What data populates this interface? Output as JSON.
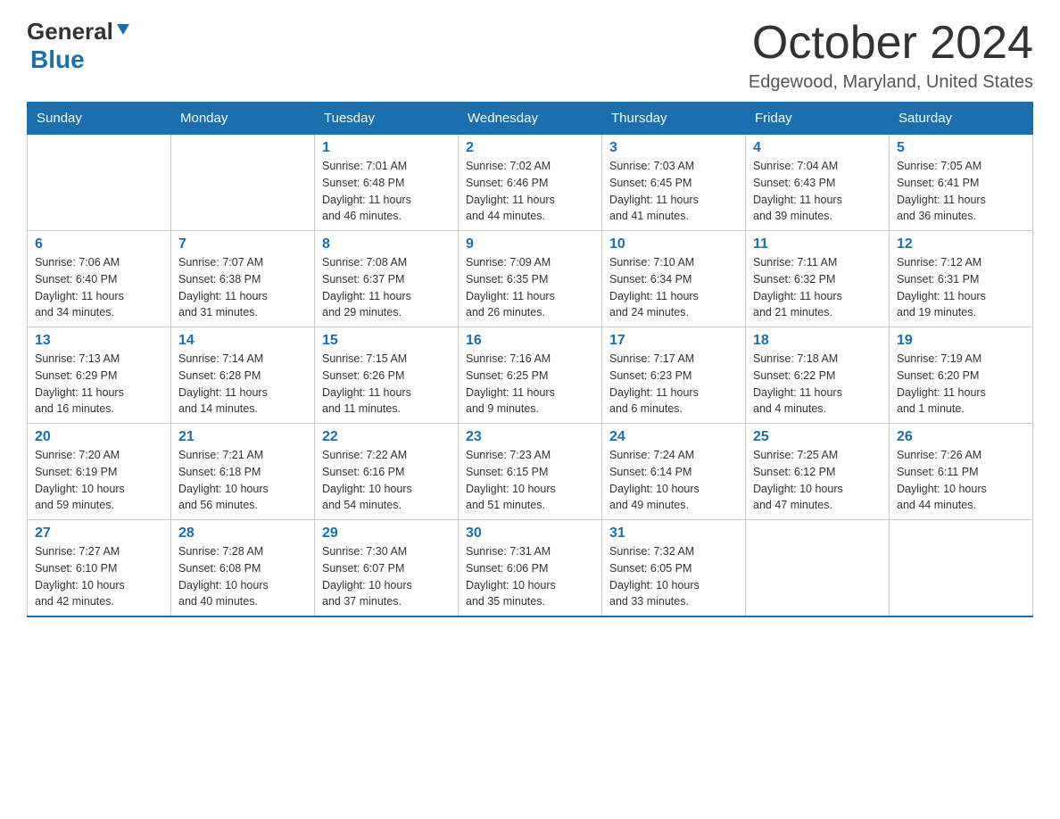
{
  "header": {
    "logo_general": "General",
    "logo_blue": "Blue",
    "title": "October 2024",
    "subtitle": "Edgewood, Maryland, United States"
  },
  "calendar": {
    "headers": [
      "Sunday",
      "Monday",
      "Tuesday",
      "Wednesday",
      "Thursday",
      "Friday",
      "Saturday"
    ],
    "weeks": [
      [
        {
          "day": "",
          "info": ""
        },
        {
          "day": "",
          "info": ""
        },
        {
          "day": "1",
          "info": "Sunrise: 7:01 AM\nSunset: 6:48 PM\nDaylight: 11 hours\nand 46 minutes."
        },
        {
          "day": "2",
          "info": "Sunrise: 7:02 AM\nSunset: 6:46 PM\nDaylight: 11 hours\nand 44 minutes."
        },
        {
          "day": "3",
          "info": "Sunrise: 7:03 AM\nSunset: 6:45 PM\nDaylight: 11 hours\nand 41 minutes."
        },
        {
          "day": "4",
          "info": "Sunrise: 7:04 AM\nSunset: 6:43 PM\nDaylight: 11 hours\nand 39 minutes."
        },
        {
          "day": "5",
          "info": "Sunrise: 7:05 AM\nSunset: 6:41 PM\nDaylight: 11 hours\nand 36 minutes."
        }
      ],
      [
        {
          "day": "6",
          "info": "Sunrise: 7:06 AM\nSunset: 6:40 PM\nDaylight: 11 hours\nand 34 minutes."
        },
        {
          "day": "7",
          "info": "Sunrise: 7:07 AM\nSunset: 6:38 PM\nDaylight: 11 hours\nand 31 minutes."
        },
        {
          "day": "8",
          "info": "Sunrise: 7:08 AM\nSunset: 6:37 PM\nDaylight: 11 hours\nand 29 minutes."
        },
        {
          "day": "9",
          "info": "Sunrise: 7:09 AM\nSunset: 6:35 PM\nDaylight: 11 hours\nand 26 minutes."
        },
        {
          "day": "10",
          "info": "Sunrise: 7:10 AM\nSunset: 6:34 PM\nDaylight: 11 hours\nand 24 minutes."
        },
        {
          "day": "11",
          "info": "Sunrise: 7:11 AM\nSunset: 6:32 PM\nDaylight: 11 hours\nand 21 minutes."
        },
        {
          "day": "12",
          "info": "Sunrise: 7:12 AM\nSunset: 6:31 PM\nDaylight: 11 hours\nand 19 minutes."
        }
      ],
      [
        {
          "day": "13",
          "info": "Sunrise: 7:13 AM\nSunset: 6:29 PM\nDaylight: 11 hours\nand 16 minutes."
        },
        {
          "day": "14",
          "info": "Sunrise: 7:14 AM\nSunset: 6:28 PM\nDaylight: 11 hours\nand 14 minutes."
        },
        {
          "day": "15",
          "info": "Sunrise: 7:15 AM\nSunset: 6:26 PM\nDaylight: 11 hours\nand 11 minutes."
        },
        {
          "day": "16",
          "info": "Sunrise: 7:16 AM\nSunset: 6:25 PM\nDaylight: 11 hours\nand 9 minutes."
        },
        {
          "day": "17",
          "info": "Sunrise: 7:17 AM\nSunset: 6:23 PM\nDaylight: 11 hours\nand 6 minutes."
        },
        {
          "day": "18",
          "info": "Sunrise: 7:18 AM\nSunset: 6:22 PM\nDaylight: 11 hours\nand 4 minutes."
        },
        {
          "day": "19",
          "info": "Sunrise: 7:19 AM\nSunset: 6:20 PM\nDaylight: 11 hours\nand 1 minute."
        }
      ],
      [
        {
          "day": "20",
          "info": "Sunrise: 7:20 AM\nSunset: 6:19 PM\nDaylight: 10 hours\nand 59 minutes."
        },
        {
          "day": "21",
          "info": "Sunrise: 7:21 AM\nSunset: 6:18 PM\nDaylight: 10 hours\nand 56 minutes."
        },
        {
          "day": "22",
          "info": "Sunrise: 7:22 AM\nSunset: 6:16 PM\nDaylight: 10 hours\nand 54 minutes."
        },
        {
          "day": "23",
          "info": "Sunrise: 7:23 AM\nSunset: 6:15 PM\nDaylight: 10 hours\nand 51 minutes."
        },
        {
          "day": "24",
          "info": "Sunrise: 7:24 AM\nSunset: 6:14 PM\nDaylight: 10 hours\nand 49 minutes."
        },
        {
          "day": "25",
          "info": "Sunrise: 7:25 AM\nSunset: 6:12 PM\nDaylight: 10 hours\nand 47 minutes."
        },
        {
          "day": "26",
          "info": "Sunrise: 7:26 AM\nSunset: 6:11 PM\nDaylight: 10 hours\nand 44 minutes."
        }
      ],
      [
        {
          "day": "27",
          "info": "Sunrise: 7:27 AM\nSunset: 6:10 PM\nDaylight: 10 hours\nand 42 minutes."
        },
        {
          "day": "28",
          "info": "Sunrise: 7:28 AM\nSunset: 6:08 PM\nDaylight: 10 hours\nand 40 minutes."
        },
        {
          "day": "29",
          "info": "Sunrise: 7:30 AM\nSunset: 6:07 PM\nDaylight: 10 hours\nand 37 minutes."
        },
        {
          "day": "30",
          "info": "Sunrise: 7:31 AM\nSunset: 6:06 PM\nDaylight: 10 hours\nand 35 minutes."
        },
        {
          "day": "31",
          "info": "Sunrise: 7:32 AM\nSunset: 6:05 PM\nDaylight: 10 hours\nand 33 minutes."
        },
        {
          "day": "",
          "info": ""
        },
        {
          "day": "",
          "info": ""
        }
      ]
    ]
  }
}
